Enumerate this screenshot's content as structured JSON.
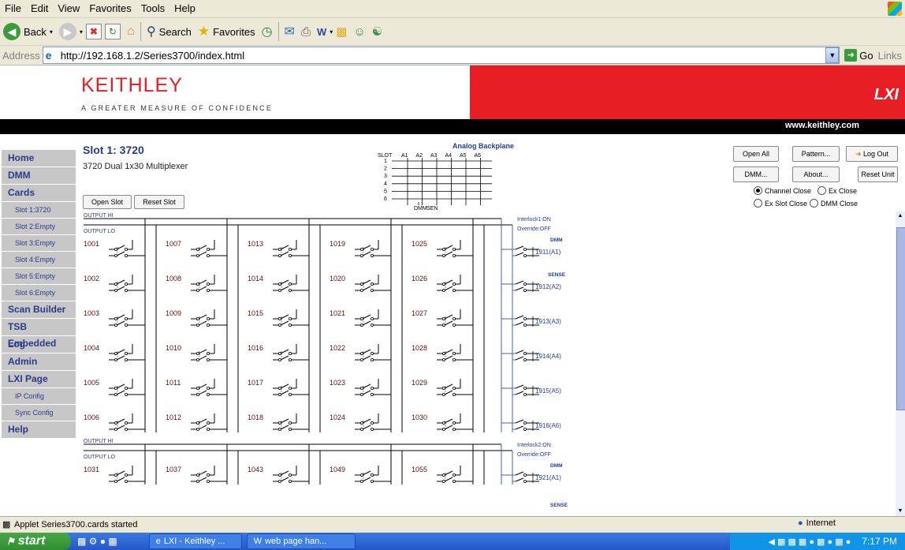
{
  "menu": [
    "File",
    "Edit",
    "View",
    "Favorites",
    "Tools",
    "Help"
  ],
  "toolbar": {
    "back": "Back",
    "search": "Search",
    "favorites": "Favorites"
  },
  "address": {
    "label": "Address",
    "url": "http://192.168.1.2/Series3700/index.html",
    "go": "Go",
    "links": "Links"
  },
  "header": {
    "logo": "KEITHLEY",
    "tagline": "A GREATER MEASURE OF CONFIDENCE",
    "lxi": "LXI",
    "website": "www.keithley.com"
  },
  "sidebar": {
    "items": [
      {
        "label": "Home",
        "sub": false
      },
      {
        "label": "DMM",
        "sub": false
      },
      {
        "label": "Cards",
        "sub": false
      },
      {
        "label": "Slot 1:3720",
        "sub": true
      },
      {
        "label": "Slot 2:Empty",
        "sub": true
      },
      {
        "label": "Slot 3:Empty",
        "sub": true
      },
      {
        "label": "Slot 4:Empty",
        "sub": true
      },
      {
        "label": "Slot 5:Empty",
        "sub": true
      },
      {
        "label": "Slot 6:Empty",
        "sub": true
      },
      {
        "label": "Scan Builder",
        "sub": false
      },
      {
        "label": "TSB Embedded",
        "sub": false
      },
      {
        "label": "Log",
        "sub": false
      },
      {
        "label": "Admin",
        "sub": false
      },
      {
        "label": "LXI Page",
        "sub": false
      },
      {
        "label": "IP Config",
        "sub": true
      },
      {
        "label": "Sync Config",
        "sub": true
      },
      {
        "label": "Help",
        "sub": false
      }
    ]
  },
  "slot": {
    "title": "Slot 1: 3720",
    "subtitle": "3720 Dual 1x30 Multiplexer",
    "open_slot": "Open Slot",
    "reset_slot": "Reset Slot"
  },
  "backplane": {
    "title": "Analog Backplane",
    "slot_label": "SLOT",
    "columns": [
      "A1",
      "A2",
      "A3",
      "A4",
      "A5",
      "A6"
    ],
    "rows": [
      "1",
      "2",
      "3",
      "4",
      "5",
      "6"
    ],
    "bottom": [
      "DMM",
      "SEN"
    ]
  },
  "actions": {
    "open_all": "Open All",
    "pattern": "Pattern...",
    "log_out": "Log Out",
    "dmm": "DMM...",
    "about": "About...",
    "reset_unit": "Reset Unit"
  },
  "close_modes": [
    {
      "label": "Channel Close",
      "selected": true
    },
    {
      "label": "Ex Close",
      "selected": false
    },
    {
      "label": "Ex Slot Close",
      "selected": false
    },
    {
      "label": "DMM Close",
      "selected": false
    }
  ],
  "diagram": {
    "output_hi": "OUTPUT HI",
    "output_lo": "OUTPUT LO",
    "bank1": {
      "interlock": "Interlock1:ON",
      "override": "Override:OFF",
      "channels": [
        [
          "1001",
          "1007",
          "1013",
          "1019",
          "1025"
        ],
        [
          "1002",
          "1008",
          "1014",
          "1020",
          "1026"
        ],
        [
          "1003",
          "1009",
          "1015",
          "1021",
          "1027"
        ],
        [
          "1004",
          "1010",
          "1016",
          "1022",
          "1028"
        ],
        [
          "1005",
          "1011",
          "1017",
          "1023",
          "1029"
        ],
        [
          "1006",
          "1012",
          "1018",
          "1024",
          "1030"
        ]
      ],
      "dmm_label": "DMM",
      "sense_label": "SENSE",
      "backplane_channels": [
        "1911(A1)",
        "1912(A2)",
        "1913(A3)",
        "1914(A4)",
        "1915(A5)",
        "1916(A6)"
      ]
    },
    "bank2": {
      "interlock": "Interlock2:ON",
      "override": "Override:OFF",
      "channels": [
        [
          "1031",
          "1037",
          "1043",
          "1049",
          "1055"
        ]
      ],
      "dmm_label": "DMM",
      "sense_label": "SENSE",
      "backplane_channels": [
        "1921(A1)"
      ]
    }
  },
  "status": {
    "text": "Applet Series3700.cards started",
    "zone": "Internet"
  },
  "taskbar": {
    "start": "start",
    "tasks": [
      "LXI - Keithley ...",
      "web page han..."
    ],
    "time": "7:17 PM"
  }
}
